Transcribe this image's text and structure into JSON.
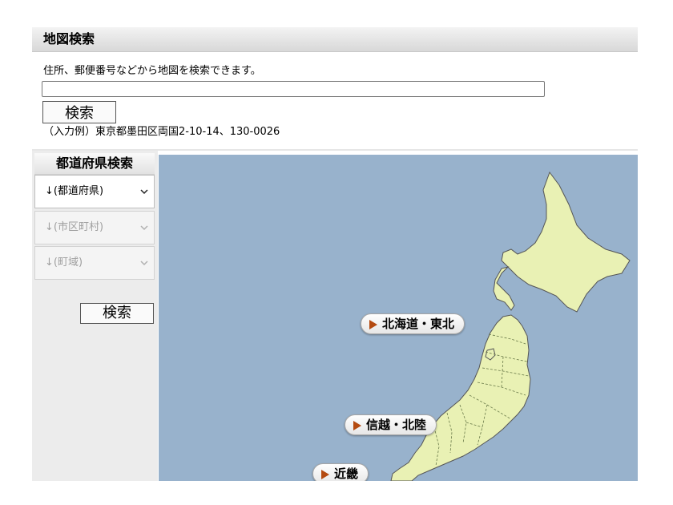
{
  "search": {
    "title": "地図検索",
    "description": "住所、郵便番号などから地図を検索できます。",
    "input_value": "",
    "button_label": "検索",
    "example": "（入力例）東京都墨田区両国2-10-14、130-0026"
  },
  "prefecture": {
    "title": "都道府県検索",
    "selects": [
      {
        "label": "↓(都道府県)",
        "disabled": false
      },
      {
        "label": "↓(市区町村)",
        "disabled": true
      },
      {
        "label": "↓(町域)",
        "disabled": true
      }
    ],
    "button_label": "検索"
  },
  "map": {
    "regions": [
      "北海道・東北",
      "信越・北陸",
      "近畿"
    ],
    "colors": {
      "sea": "#98b2cc",
      "land": "#e9f1b4",
      "border": "#6a7a4a",
      "accent": "#b44a10"
    }
  }
}
